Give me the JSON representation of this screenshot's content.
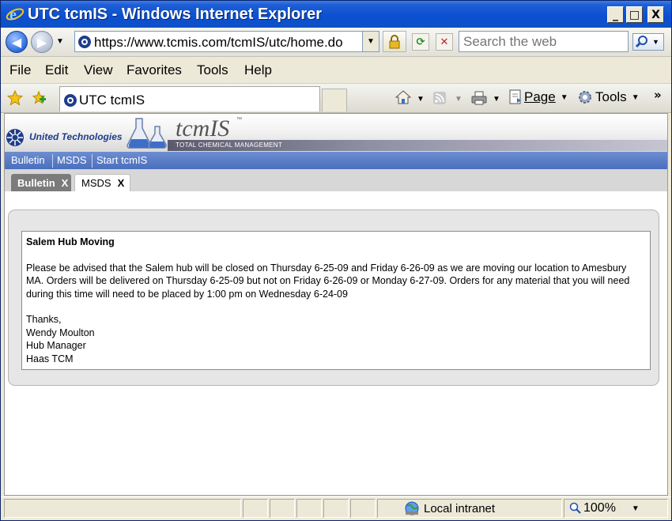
{
  "window": {
    "title": "UTC tcmIS - Windows Internet Explorer",
    "minimize": "_",
    "maximize": "□",
    "close": "X"
  },
  "address_bar": {
    "url": "https://www.tcmis.com/tcmIS/utc/home.do",
    "search_placeholder": "Search the web"
  },
  "menu": [
    "File",
    "Edit",
    "View",
    "Favorites",
    "Tools",
    "Help"
  ],
  "tab": {
    "title": "UTC tcmIS"
  },
  "command_bar": {
    "page_label": "Page",
    "tools_label": "Tools"
  },
  "banner": {
    "company": "United Technologies",
    "product": "tcmIS",
    "trademark": "™",
    "tagline": "TOTAL CHEMICAL MANAGEMENT"
  },
  "app_nav": [
    "Bulletin",
    "MSDS",
    "Start tcmIS"
  ],
  "app_tabs": [
    {
      "label": "Bulletin",
      "close": "X",
      "active": true
    },
    {
      "label": "MSDS",
      "close": "X",
      "active": false
    }
  ],
  "notice": {
    "title": "Salem Hub Moving",
    "body": "Please be advised that the Salem hub will be closed on Thursday 6-25-09 and Friday 6-26-09 as we are moving our location to Amesbury MA. Orders will be delivered on Thursday 6-25-09 but not on Friday 6-26-09 or Monday 6-27-09. Orders for any material that you will need during this time will need to be placed by 1:00 pm on Wednesday 6-24-09",
    "signoff": [
      "Thanks,",
      "Wendy Moulton",
      "Hub Manager",
      "Haas TCM"
    ]
  },
  "status_bar": {
    "zone": "Local intranet",
    "zoom": "100%"
  }
}
